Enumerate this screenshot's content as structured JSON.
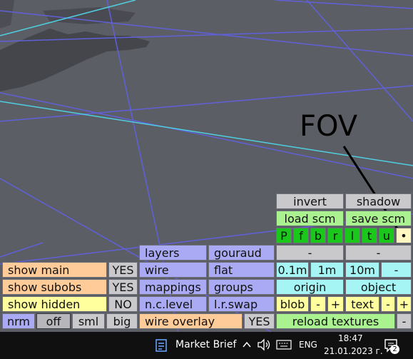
{
  "annotation": {
    "text": "FOV"
  },
  "panel": {
    "invert": "invert",
    "shadow": "shadow",
    "load_scm": "load scm",
    "save_scm": "save scm",
    "letters": [
      "P",
      "f",
      "b",
      "r",
      "l",
      "t",
      "u"
    ],
    "fov_dot": "•",
    "layers": "layers",
    "gouraud": "gouraud",
    "minus1": "-",
    "minus2": "-",
    "show_main": "show main",
    "show_main_val": "YES",
    "wire": "wire",
    "flat": "flat",
    "d01": "0.1m",
    "d1": "1m",
    "d10": "10m",
    "dminus": "-",
    "show_subobs": "show subobs",
    "show_subobs_val": "YES",
    "mappings": "mappings",
    "groups": "groups",
    "origin": "origin",
    "object": "object",
    "show_hidden": "show hidden",
    "show_hidden_val": "NO",
    "nc_level": "n.c.level",
    "lr_swap": "l.r.swap",
    "blob": "blob",
    "blob_minus": "-",
    "blob_plus": "+",
    "text": "text",
    "text_minus": "-",
    "text_plus": "+",
    "nrm": "nrm",
    "off": "off",
    "sml": "sml",
    "big": "big",
    "wire_overlay": "wire overlay",
    "wire_overlay_val": "YES",
    "reload_textures": "reload textures",
    "reload_minus": "-"
  },
  "taskbar": {
    "app_label": "Market Brief",
    "lang": "ENG",
    "time": "18:47",
    "date": "21.01.2023 г.",
    "notification_count": "2",
    "icons": [
      "news-icon",
      "chevron-up-icon",
      "speaker-icon",
      "keyboard-icon",
      "notifications-icon"
    ]
  }
}
